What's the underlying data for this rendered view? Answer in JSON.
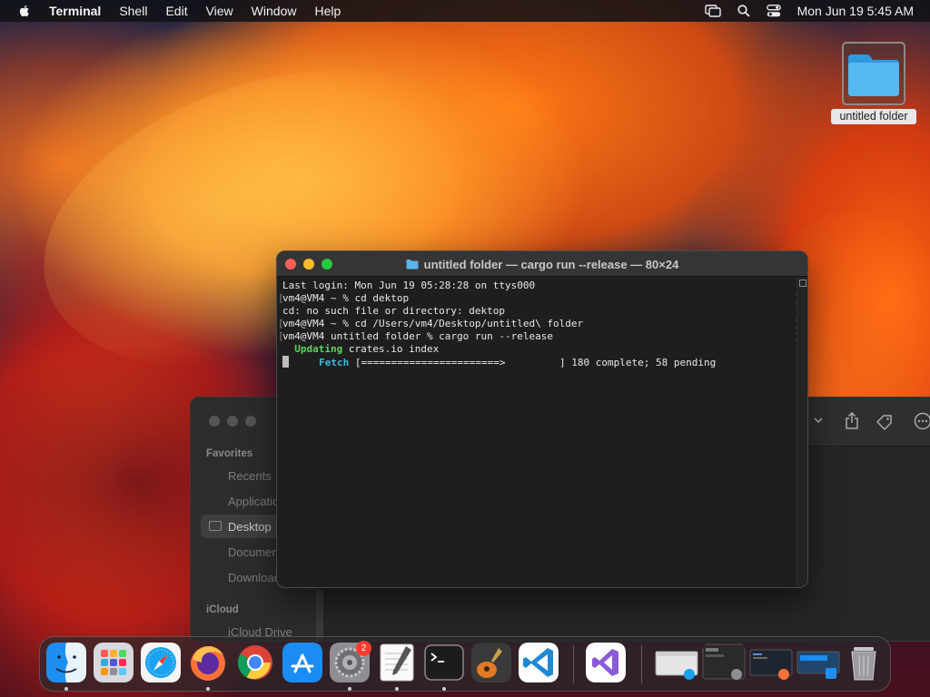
{
  "menubar": {
    "app_name": "Terminal",
    "menus": [
      "Shell",
      "Edit",
      "View",
      "Window",
      "Help"
    ],
    "clock": "Mon Jun 19  5:45 AM"
  },
  "desktop": {
    "icon_label": "untitled folder"
  },
  "finder": {
    "sidebar": {
      "favorites_header": "Favorites",
      "items": [
        "Recents",
        "Applications",
        "Desktop",
        "Documents",
        "Downloads"
      ],
      "icloud_header": "iCloud",
      "icloud_items": [
        "iCloud Drive"
      ]
    }
  },
  "terminal": {
    "title": "untitled folder — cargo run --release — 80×24",
    "lines": [
      "Last login: Mon Jun 19 05:28:28 on ttys000",
      "vm4@VM4 ~ % cd dektop",
      "cd: no such file or directory: dektop",
      "vm4@VM4 ~ % cd /Users/vm4/Desktop/untitled\\ folder",
      "vm4@VM4 untitled folder % cargo run --release"
    ],
    "updating_keyword": "Updating",
    "updating_text": " crates.io index",
    "fetch_keyword": "Fetch",
    "fetch_text": " [=======================>         ] 180 complete; 58 pending"
  },
  "dock": {
    "apps": [
      "Finder",
      "Launchpad",
      "Safari",
      "Firefox",
      "Google Chrome",
      "App Store",
      "System Settings",
      "TextEdit",
      "Terminal",
      "GarageBand",
      "Visual Studio Code",
      "Visual Studio",
      "Finder window",
      "Terminal window",
      "Code window",
      "Downloads window",
      "Trash"
    ],
    "settings_badge": "2"
  },
  "colors": {
    "terminal_green": "#5fd35f",
    "terminal_cyan": "#3fb8e0",
    "close": "#fe5f57",
    "minimize": "#febc2e",
    "maximize": "#28c840"
  }
}
